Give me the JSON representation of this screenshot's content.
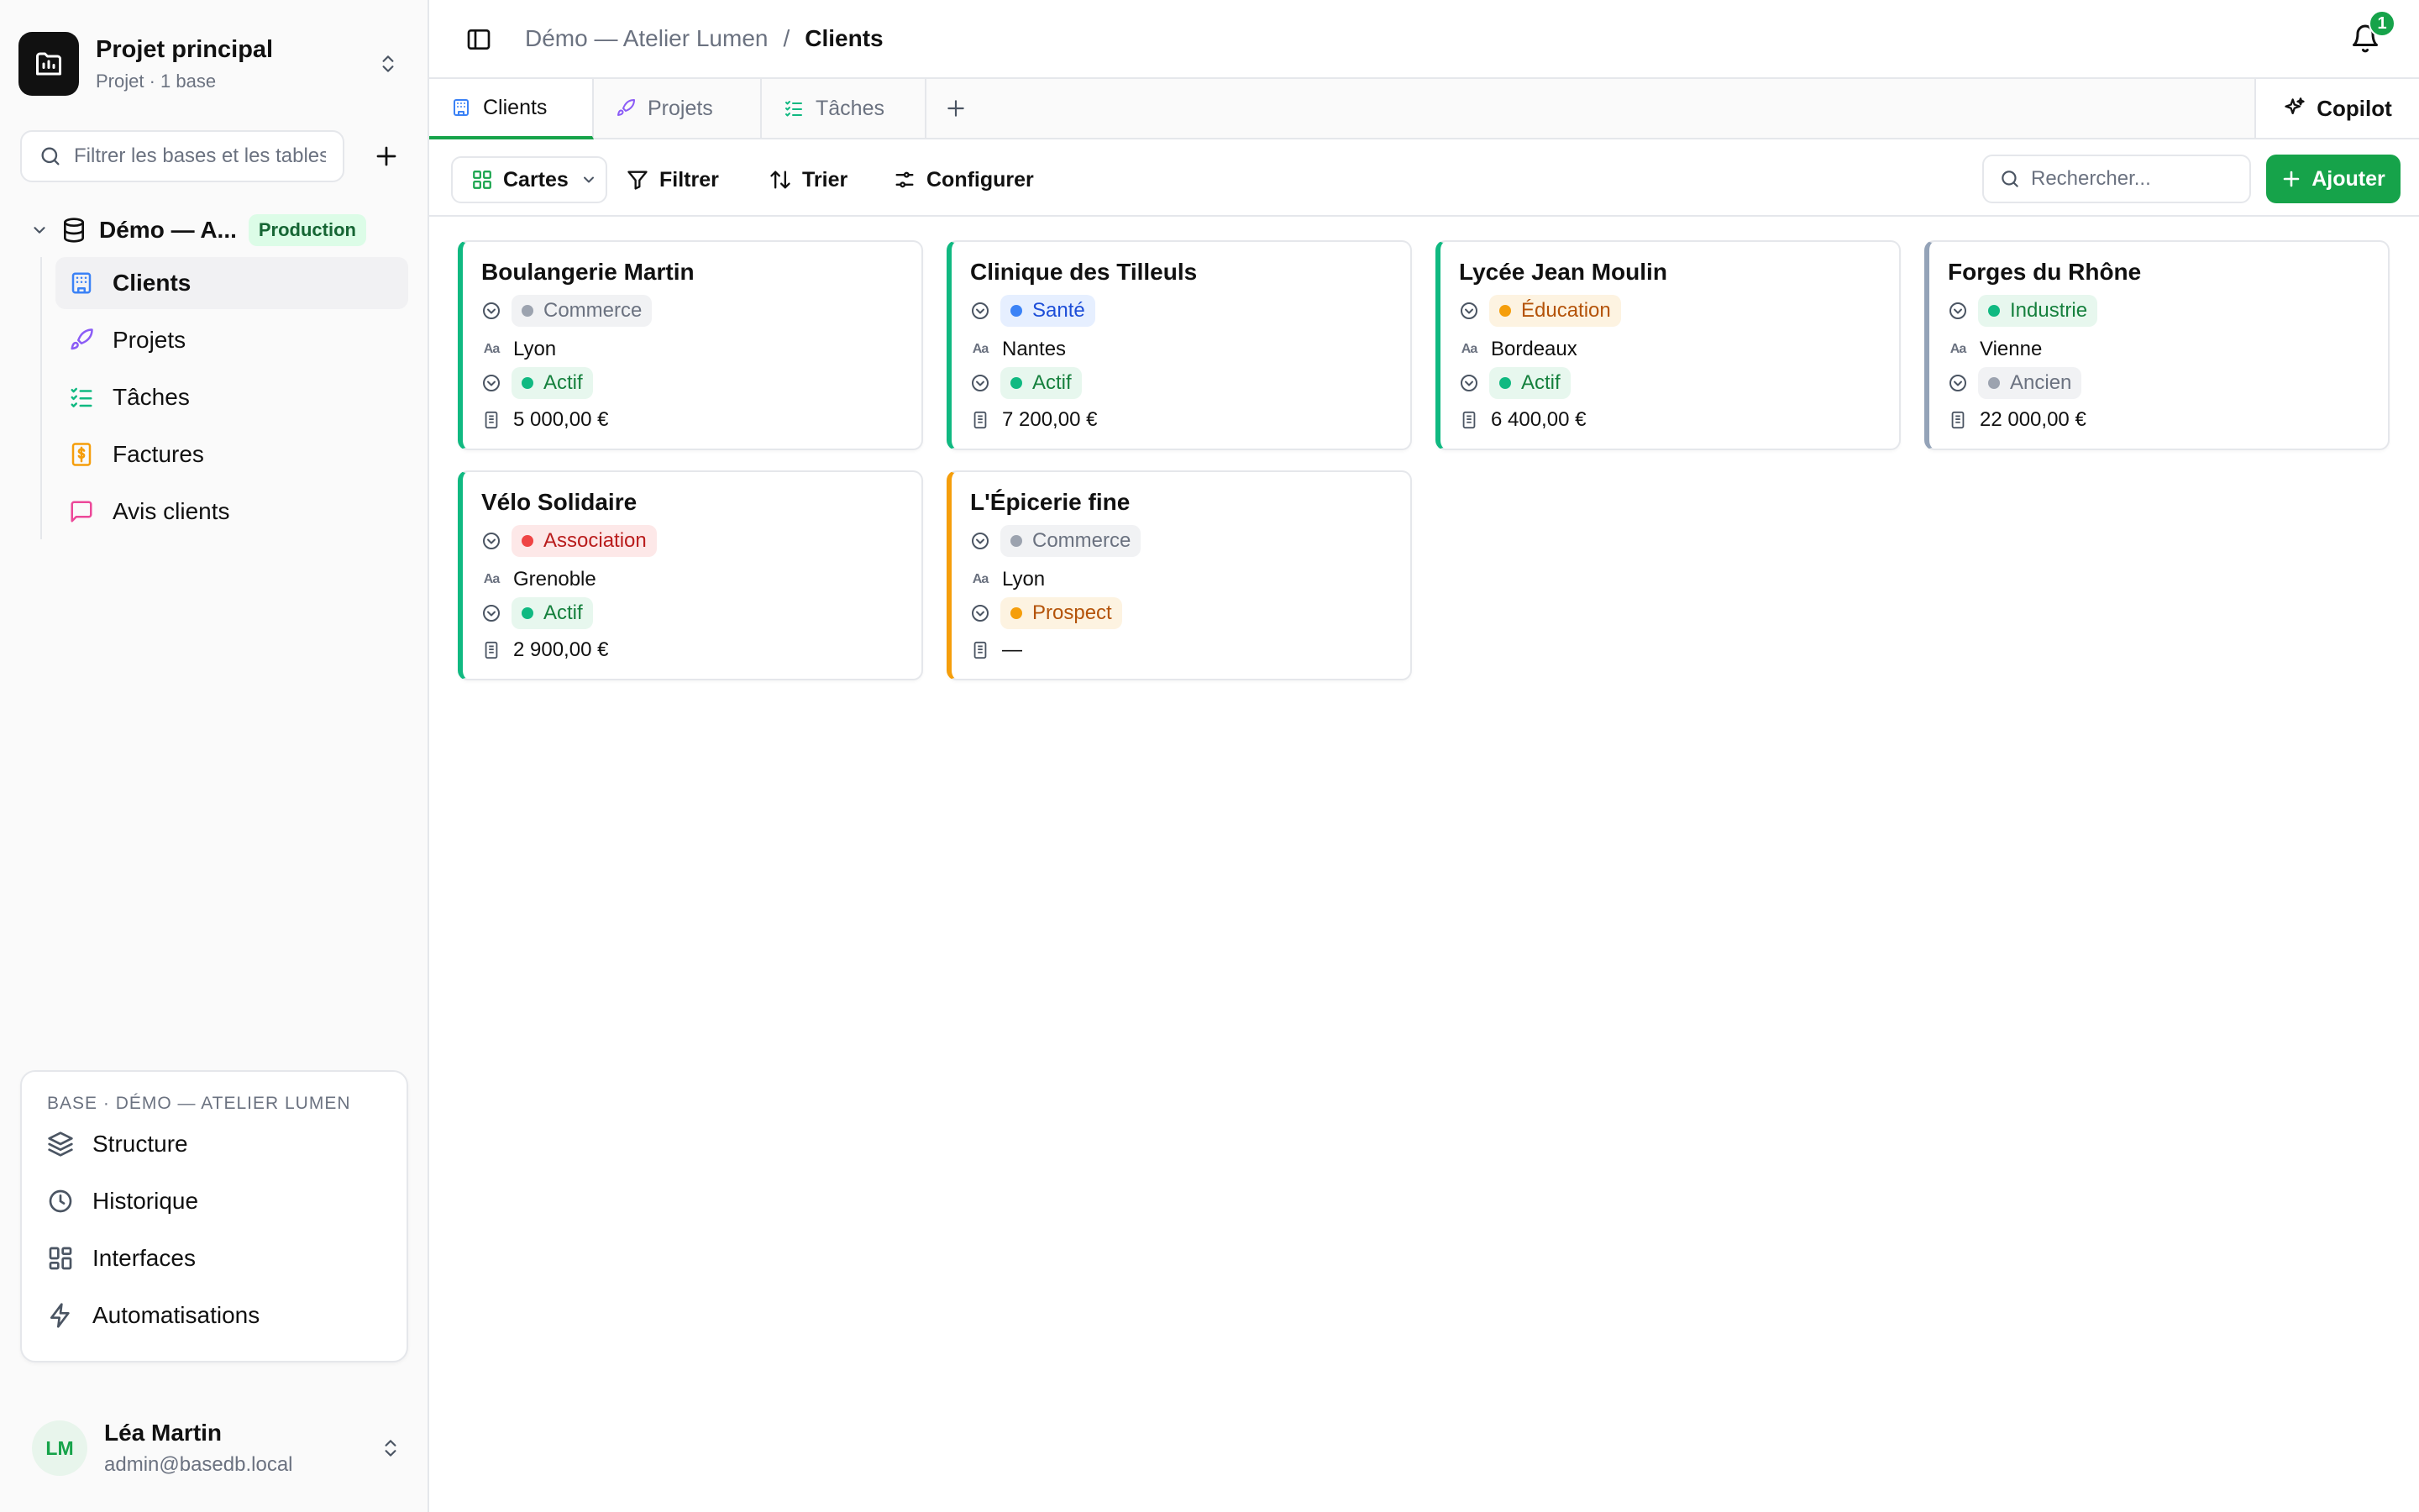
{
  "project": {
    "name": "Projet principal",
    "subtitle": "Projet · 1 base"
  },
  "sidebar": {
    "filter_placeholder": "Filtrer les bases et les tables",
    "base_name": "Démo — A...",
    "base_badge": "Production",
    "tables": [
      {
        "label": "Clients",
        "icon": "building-icon",
        "color": "#3b82f6",
        "active": true
      },
      {
        "label": "Projets",
        "icon": "rocket-icon",
        "color": "#8b5cf6",
        "active": false
      },
      {
        "label": "Tâches",
        "icon": "checklist-icon",
        "color": "#10b981",
        "active": false
      },
      {
        "label": "Factures",
        "icon": "receipt-icon",
        "color": "#f59e0b",
        "active": false
      },
      {
        "label": "Avis clients",
        "icon": "message-icon",
        "color": "#ec4899",
        "active": false
      }
    ],
    "panel": {
      "title": "BASE · DÉMO — ATELIER LUMEN",
      "items": [
        {
          "label": "Structure",
          "icon": "layers-icon"
        },
        {
          "label": "Historique",
          "icon": "clock-icon"
        },
        {
          "label": "Interfaces",
          "icon": "grid-icon"
        },
        {
          "label": "Automatisations",
          "icon": "bolt-icon"
        }
      ]
    },
    "user": {
      "initials": "LM",
      "name": "Léa Martin",
      "email": "admin@basedb.local"
    }
  },
  "header": {
    "breadcrumb_base": "Démo — Atelier Lumen",
    "breadcrumb_sep": "/",
    "breadcrumb_current": "Clients",
    "notification_count": "1"
  },
  "tabs": [
    {
      "label": "Clients",
      "icon": "building-icon",
      "active": true
    },
    {
      "label": "Projets",
      "icon": "rocket-icon",
      "active": false
    },
    {
      "label": "Tâches",
      "icon": "checklist-icon",
      "active": false
    }
  ],
  "copilot_label": "Copilot",
  "toolbar": {
    "view_label": "Cartes",
    "filter_label": "Filtrer",
    "sort_label": "Trier",
    "configure_label": "Configurer",
    "search_placeholder": "Rechercher...",
    "add_label": "Ajouter"
  },
  "colors": {
    "accent": "#16a34a",
    "status_actif": "#10b981",
    "status_ancien": "#94a3b8",
    "status_prospect": "#f59e0b"
  },
  "cards": [
    {
      "name": "Boulangerie Martin",
      "sector": "Commerce",
      "city": "Lyon",
      "status": "Actif",
      "amount": "5 000,00 €",
      "accent": "#10b981",
      "sector_bg": "#f1f2f4",
      "sector_dot": "#9ca3af",
      "sector_text": "#6b7280",
      "status_bg": "#e7f7ee",
      "status_dot": "#10b981",
      "status_text": "#15803d"
    },
    {
      "name": "Clinique des Tilleuls",
      "sector": "Santé",
      "city": "Nantes",
      "status": "Actif",
      "amount": "7 200,00 €",
      "accent": "#10b981",
      "sector_bg": "#e6efff",
      "sector_dot": "#3b82f6",
      "sector_text": "#1d4ed8",
      "status_bg": "#e7f7ee",
      "status_dot": "#10b981",
      "status_text": "#15803d"
    },
    {
      "name": "Lycée Jean Moulin",
      "sector": "Éducation",
      "city": "Bordeaux",
      "status": "Actif",
      "amount": "6 400,00 €",
      "accent": "#10b981",
      "sector_bg": "#fdf3e1",
      "sector_dot": "#f59e0b",
      "sector_text": "#b45309",
      "status_bg": "#e7f7ee",
      "status_dot": "#10b981",
      "status_text": "#15803d"
    },
    {
      "name": "Forges du Rhône",
      "sector": "Industrie",
      "city": "Vienne",
      "status": "Ancien",
      "amount": "22 000,00 €",
      "accent": "#94a3b8",
      "sector_bg": "#e7f7ee",
      "sector_dot": "#10b981",
      "sector_text": "#15803d",
      "status_bg": "#f1f2f4",
      "status_dot": "#9ca3af",
      "status_text": "#6b7280"
    },
    {
      "name": "Vélo Solidaire",
      "sector": "Association",
      "city": "Grenoble",
      "status": "Actif",
      "amount": "2 900,00 €",
      "accent": "#10b981",
      "sector_bg": "#fde8e8",
      "sector_dot": "#ef4444",
      "sector_text": "#b91c1c",
      "status_bg": "#e7f7ee",
      "status_dot": "#10b981",
      "status_text": "#15803d"
    },
    {
      "name": "L'Épicerie fine",
      "sector": "Commerce",
      "city": "Lyon",
      "status": "Prospect",
      "amount": "—",
      "accent": "#f59e0b",
      "sector_bg": "#f1f2f4",
      "sector_dot": "#9ca3af",
      "sector_text": "#6b7280",
      "status_bg": "#fdf3e1",
      "status_dot": "#f59e0b",
      "status_text": "#b45309"
    }
  ]
}
